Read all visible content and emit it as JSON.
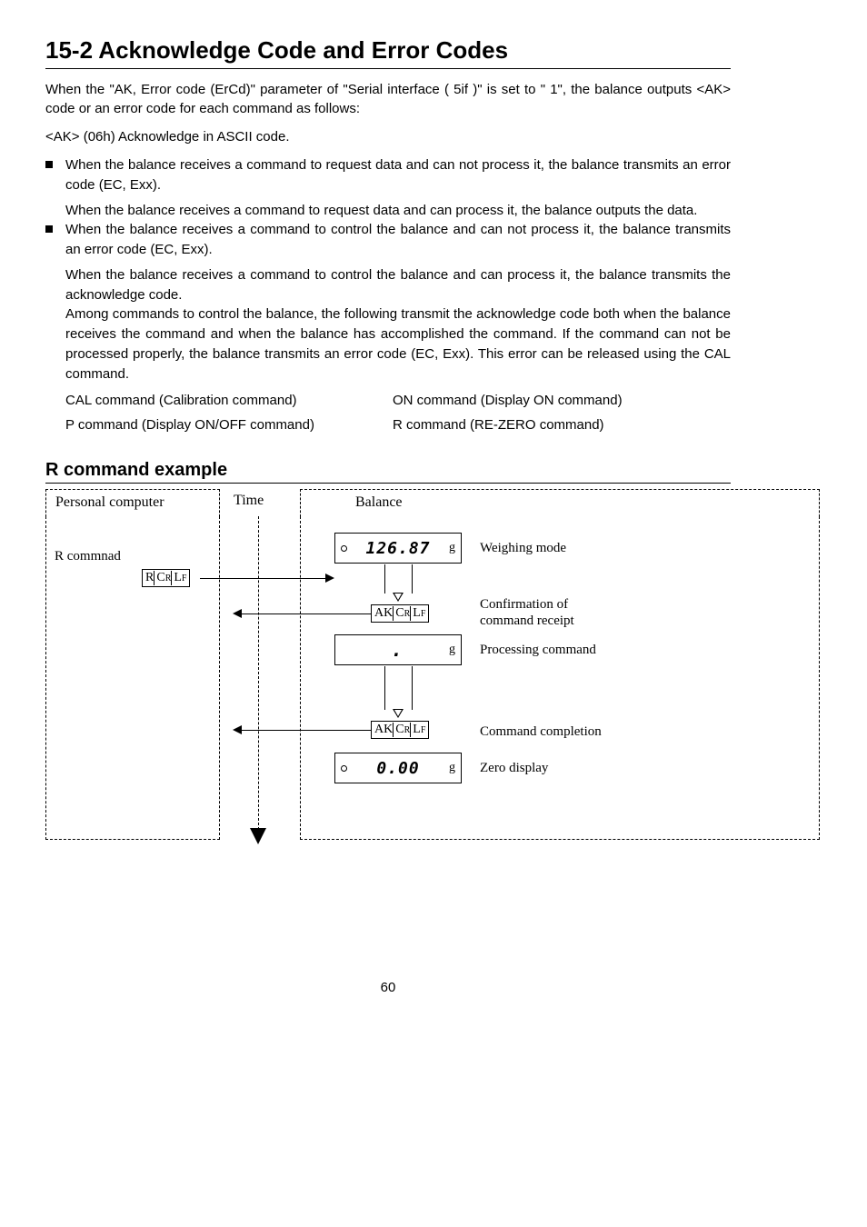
{
  "title": "15-2 Acknowledge Code and Error Codes",
  "intro": "When the \"AK, Error code (ErCd)\" parameter of \"Serial interface ( 5if )\" is set to \" 1\", the balance outputs <AK> code or an error code for each command as follows:",
  "ak_line": "<AK> (06h) Acknowledge in ASCII code.",
  "bullet1": "When the balance receives a command to request data and can not process it, the balance transmits an error code (EC, Exx).",
  "bullet1_cont": "When the balance receives a command to request data and can process it, the balance outputs the data.",
  "bullet2": "When the balance receives a command to control the balance and can not process it, the balance transmits an error code (EC, Exx).",
  "bullet2_cont1": "When the balance receives a command to control the balance and can process it, the balance transmits the acknowledge code.",
  "bullet2_cont2": "Among commands to control the balance, the following transmit the acknowledge code both when the balance receives the command and when the balance has accomplished the command. If the command can not be processed properly, the balance transmits an error code (EC, Exx). This error can be released using the CAL command.",
  "cmd_cal": "CAL command (Calibration command)",
  "cmd_on": "ON command (Display ON command)",
  "cmd_p": "P command (Display ON/OFF command)",
  "cmd_r": "R command (RE-ZERO command)",
  "subheading": "R command example",
  "diagram": {
    "pc_header": "Personal computer",
    "time": "Time",
    "balance_header": "Balance",
    "r_command": "R commnad",
    "chip_r": {
      "main": "R ",
      "cr": "C",
      "crsub": "R",
      "lf": "L",
      "lfsub": "F"
    },
    "chip_ak": {
      "ak": "AK",
      "cr": "C",
      "crsub": "R",
      "lf": "L",
      "lfsub": "F"
    },
    "lcd1": {
      "value": "126.87",
      "unit": "g"
    },
    "lcd2": {
      "value": ".",
      "unit": "g"
    },
    "lcd3": {
      "value": "0.00",
      "unit": "g"
    },
    "desc_weighing": "Weighing mode",
    "desc_confirm1": "Confirmation of",
    "desc_confirm2": "command receipt",
    "desc_processing": "Processing command",
    "desc_completion": "Command completion",
    "desc_zero": "Zero display"
  },
  "page": "60"
}
